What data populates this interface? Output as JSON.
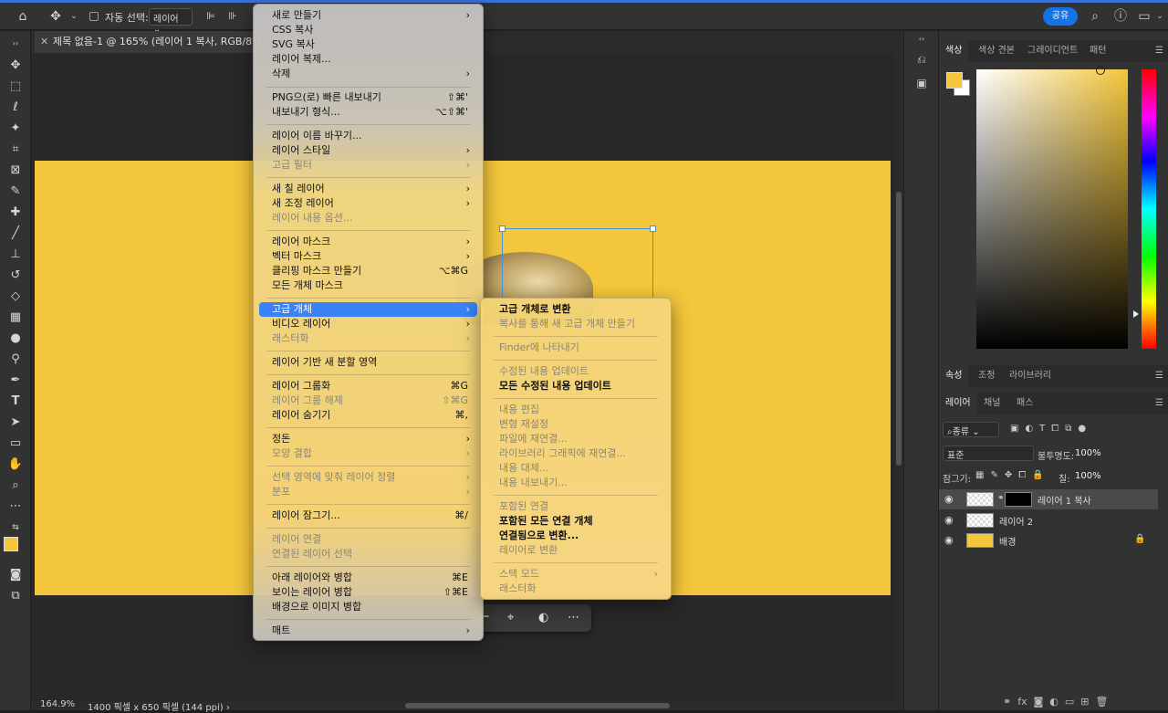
{
  "optionsbar": {
    "autoselect_label": "자동 선택:",
    "autoselect_value": "레이어 ⌄",
    "share": "공유"
  },
  "document": {
    "tab_title": "제목 없음-1 @ 165% (레이어 1 복사, RGB/8*) *",
    "zoom": "164.9%",
    "doc_info": "1400 픽셀 x 650 픽셀 (144 ppi)  ›"
  },
  "main_menu": {
    "new": "새로 만들기",
    "copy_css": "CSS 복사",
    "copy_svg": "SVG 복사",
    "duplicate_layer": "레이어 복제...",
    "delete": "삭제",
    "quick_export": "PNG으(로) 빠른 내보내기",
    "quick_export_sc": "⇧⌘'",
    "export_as": "내보내기 형식...",
    "export_as_sc": "⌥⇧⌘'",
    "rename_layer": "레이어 이름 바꾸기...",
    "layer_style": "레이어 스타일",
    "smart_filter": "고급 필터",
    "new_fill_layer": "새 칠 레이어",
    "new_adjustment_layer": "새 조정 레이어",
    "layer_content_options": "레이어 내용 옵션...",
    "layer_mask": "레이어 마스크",
    "vector_mask": "벡터 마스크",
    "create_clipping_mask": "클리핑 마스크 만들기",
    "create_clipping_mask_sc": "⌥⌘G",
    "mask_all_objects": "모든 개체 마스크",
    "smart_objects": "고급 개체",
    "video_layers": "비디오 레이어",
    "rasterize": "래스터화",
    "new_layer_based_slice": "레이어 기반 새 분할 영역",
    "group_layers": "레이어 그룹화",
    "group_layers_sc": "⌘G",
    "ungroup_layers": "레이어 그룹 해제",
    "ungroup_layers_sc": "⇧⌘G",
    "hide_layers": "레이어 숨기기",
    "hide_layers_sc": "⌘,",
    "arrange": "정돈",
    "combine_shapes": "모양 결합",
    "align_to_selection": "선택 영역에 맞춰 레이어 정렬",
    "distribute": "분포",
    "lock_layers": "레이어 잠그기...",
    "lock_layers_sc": "⌘/",
    "link_layers": "레이어 연결",
    "select_linked_layers": "연결된 레이어 선택",
    "merge_down": "아래 레이어와 병합",
    "merge_down_sc": "⌘E",
    "merge_visible": "보이는 레이어 병합",
    "merge_visible_sc": "⇧⌘E",
    "flatten_image": "배경으로 이미지 병합",
    "matting": "매트"
  },
  "sub_menu": {
    "convert_to_smart_object": "고급 개체로 변환",
    "new_smart_object_via_copy": "복사를 통해 새 고급 개체 만들기",
    "reveal_in_finder": "Finder에 나타내기",
    "update_modified_content": "수정된 내용 업데이트",
    "update_all_modified_content": "모든 수정된 내용 업데이트",
    "edit_contents": "내용 편집",
    "reset_transform": "변형 재설정",
    "relink_to_file": "파일에 재연결...",
    "relink_to_library_graphic": "라이브러리 그래픽에 재연결...",
    "replace_contents": "내용 대체...",
    "export_contents": "내용 내보내기...",
    "embedded_links": "포함된 연결",
    "embed_all_linked": "포함된 모든 연결 개체",
    "convert_to_linked": "연결됨으로 변환...",
    "convert_to_layers": "레이어로 변환",
    "stack_mode": "스택 모드",
    "rasterize": "래스터화"
  },
  "color_panel": {
    "tabs": [
      "색상",
      "색상 견본",
      "그레이디언트",
      "패턴"
    ],
    "foreground": "#f4c63b"
  },
  "layers_panel": {
    "top_tabs": [
      "속성",
      "조정",
      "라이브러리"
    ],
    "tabs": [
      "레이어",
      "채널",
      "패스"
    ],
    "filter_kind": "종류",
    "blend_mode": "표준",
    "opacity_label": "불투명도:",
    "opacity_value": "100%",
    "lock_label": "잠그기:",
    "fill_label": "칠:",
    "fill_value": "100%",
    "layers": [
      {
        "name": "레이어 1 복사"
      },
      {
        "name": "레이어 2"
      },
      {
        "name": "배경"
      }
    ]
  }
}
